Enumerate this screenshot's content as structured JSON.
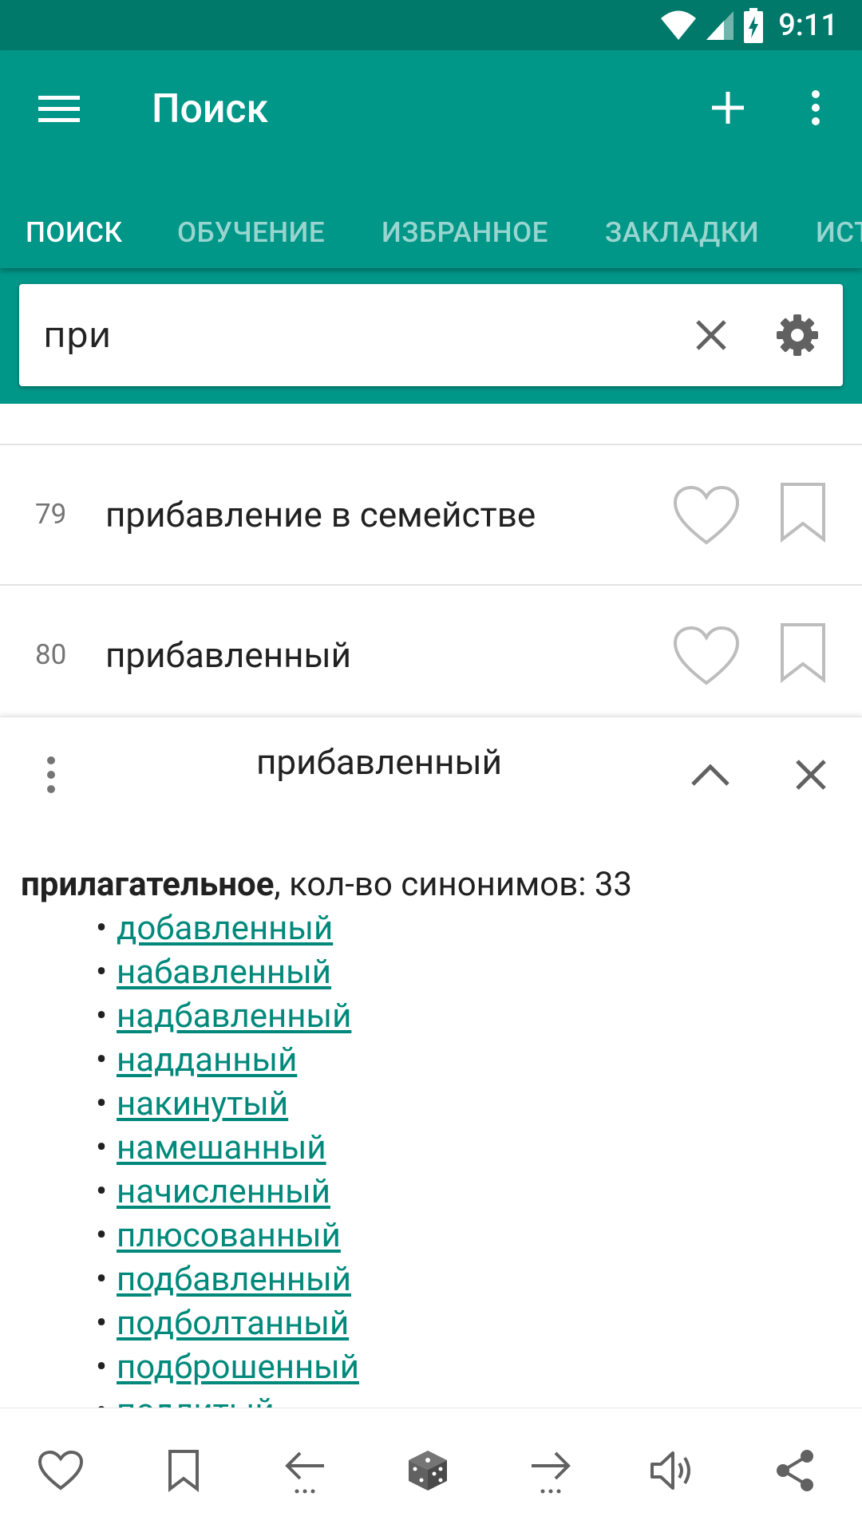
{
  "status_bar": {
    "time": "9:11",
    "icons": [
      "wifi-icon",
      "cellular-signal-icon",
      "battery-charging-icon"
    ]
  },
  "app_bar": {
    "title": "Поиск",
    "icons": [
      "menu-icon",
      "add-icon",
      "more-vert-icon"
    ]
  },
  "tabs": [
    {
      "label": "ПОИСК",
      "active": true
    },
    {
      "label": "ОБУЧЕНИЕ",
      "active": false
    },
    {
      "label": "ИЗБРАННОЕ",
      "active": false
    },
    {
      "label": "ЗАКЛАДКИ",
      "active": false
    },
    {
      "label": "ИСТ",
      "active": false
    }
  ],
  "search": {
    "value": "при",
    "icons": [
      "clear-icon",
      "settings-icon"
    ]
  },
  "results": [
    {
      "number": "79",
      "word": "прибавление в семействе"
    },
    {
      "number": "80",
      "word": "прибавленный"
    }
  ],
  "detail": {
    "title": "прибавленный",
    "part_of_speech": "прилагательное",
    "synonym_count_text": ", кол-во синонимов: 33",
    "bullet": "•",
    "synonyms": [
      "добавленный",
      "набавленный",
      "надбавленный",
      "надданный",
      "накинутый",
      "намешанный",
      "начисленный",
      "плюсованный",
      "подбавленный",
      "подболтанный",
      "подброшенный",
      "подлитый"
    ]
  },
  "bottom_bar": {
    "icons": [
      "heart-icon",
      "bookmark-icon",
      "arrow-back-icon",
      "dice-icon",
      "arrow-forward-icon",
      "volume-icon",
      "share-icon"
    ]
  },
  "colors": {
    "primary": "#009688",
    "primary_dark": "#00796b",
    "link": "#00897b"
  }
}
